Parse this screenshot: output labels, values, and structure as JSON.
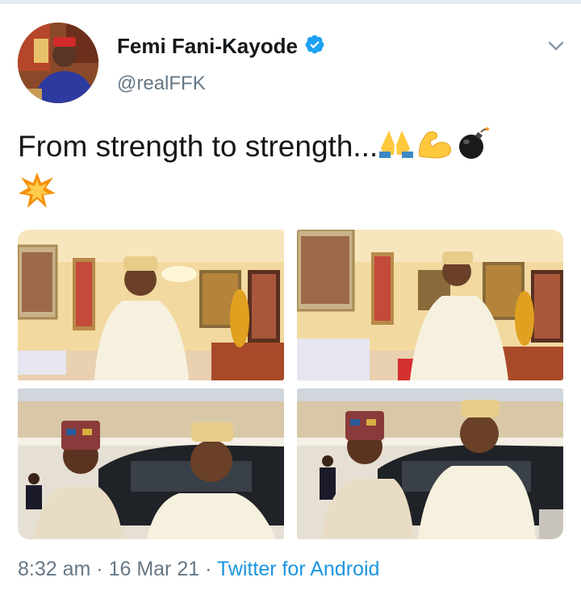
{
  "tweet": {
    "author_name": "Femi Fani-Kayode",
    "author_handle": "@realFFK",
    "verified": true,
    "text": "From strength to strength...",
    "emojis": [
      "folded-hands-emoji",
      "flexed-biceps-emoji",
      "bomb-emoji",
      "collision-emoji"
    ],
    "time": "8:32 am",
    "separator": "·",
    "date": "16 Mar 21",
    "source": "Twitter for Android",
    "photos": [
      "photo-1",
      "photo-2",
      "photo-3",
      "photo-4"
    ]
  },
  "colors": {
    "link_blue": "#1b95e0",
    "muted_gray": "#657786",
    "text_dark": "#14171a",
    "verified_blue": "#1da1f2"
  },
  "icons": {
    "verified": "verified-badge-icon",
    "menu": "chevron-down-icon"
  }
}
